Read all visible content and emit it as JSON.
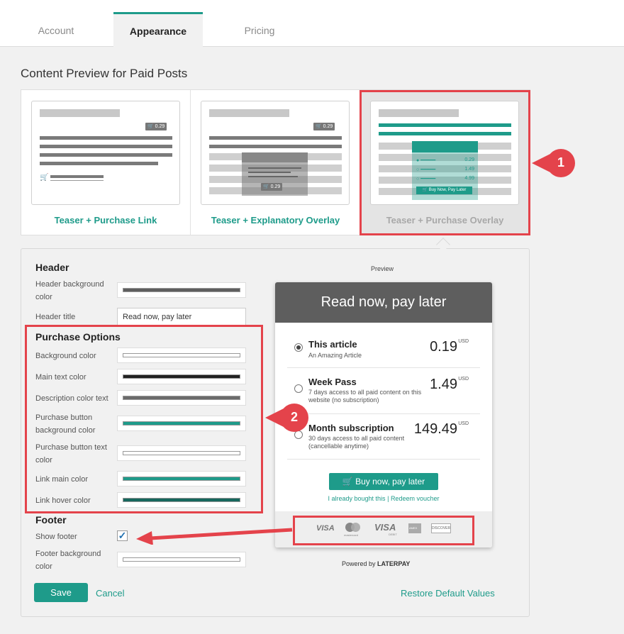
{
  "tabs": [
    {
      "label": "Account"
    },
    {
      "label": "Appearance"
    },
    {
      "label": "Pricing"
    }
  ],
  "section_title": "Content Preview for Paid Posts",
  "preview_options": [
    {
      "label": "Teaser + Purchase Link",
      "thumb_price": "0.29"
    },
    {
      "label": "Teaser + Explanatory Overlay",
      "thumb_price": "0.29"
    },
    {
      "label": "Teaser + Purchase Overlay",
      "thumb_prices": [
        "0.29",
        "1.49",
        "4.99"
      ],
      "thumb_button": "Buy Now, Pay Later"
    }
  ],
  "header": {
    "title": "Header",
    "bg_label": "Header background color",
    "title_label": "Header title",
    "title_value": "Read now, pay later"
  },
  "purchase_options": {
    "title": "Purchase Options",
    "fields": [
      {
        "label": "Background color"
      },
      {
        "label": "Main text color"
      },
      {
        "label": "Description color text"
      },
      {
        "label": "Purchase button background color"
      },
      {
        "label": "Purchase button text color"
      },
      {
        "label": "Link main color"
      },
      {
        "label": "Link hover color"
      }
    ]
  },
  "footer": {
    "title": "Footer",
    "show_label": "Show footer",
    "bg_label": "Footer background color"
  },
  "colors": {
    "accent": "#1e9b8a",
    "header_bg": "#5e5e5e",
    "annotation": "#e4434b"
  },
  "preview": {
    "label": "Preview",
    "header": "Read now, pay later",
    "options": [
      {
        "name": "This article",
        "desc": "An Amazing Article",
        "price": "0.19",
        "currency": "USD",
        "selected": true
      },
      {
        "name": "Week Pass",
        "desc": "7 days access to all paid content on this website (no subscription)",
        "price": "1.49",
        "currency": "USD",
        "selected": false
      },
      {
        "name": "Month subscription",
        "desc": "30 days access to all paid content (cancellable anytime)",
        "price": "149.49",
        "currency": "USD",
        "selected": false
      }
    ],
    "buy_button": "Buy now, pay later",
    "already_bought": "I already bought this",
    "separator": "|",
    "redeem": "Redeem voucher",
    "payment_methods": [
      "VISA",
      "mastercard",
      "VISA",
      "AMEX",
      "DISCOVER"
    ],
    "visa_debit_caption": "DEBIT",
    "powered_by": "Powered by",
    "brand": "LATERPAY"
  },
  "actions": {
    "save": "Save",
    "cancel": "Cancel",
    "restore": "Restore Default Values"
  },
  "annotations": [
    "1",
    "2"
  ]
}
